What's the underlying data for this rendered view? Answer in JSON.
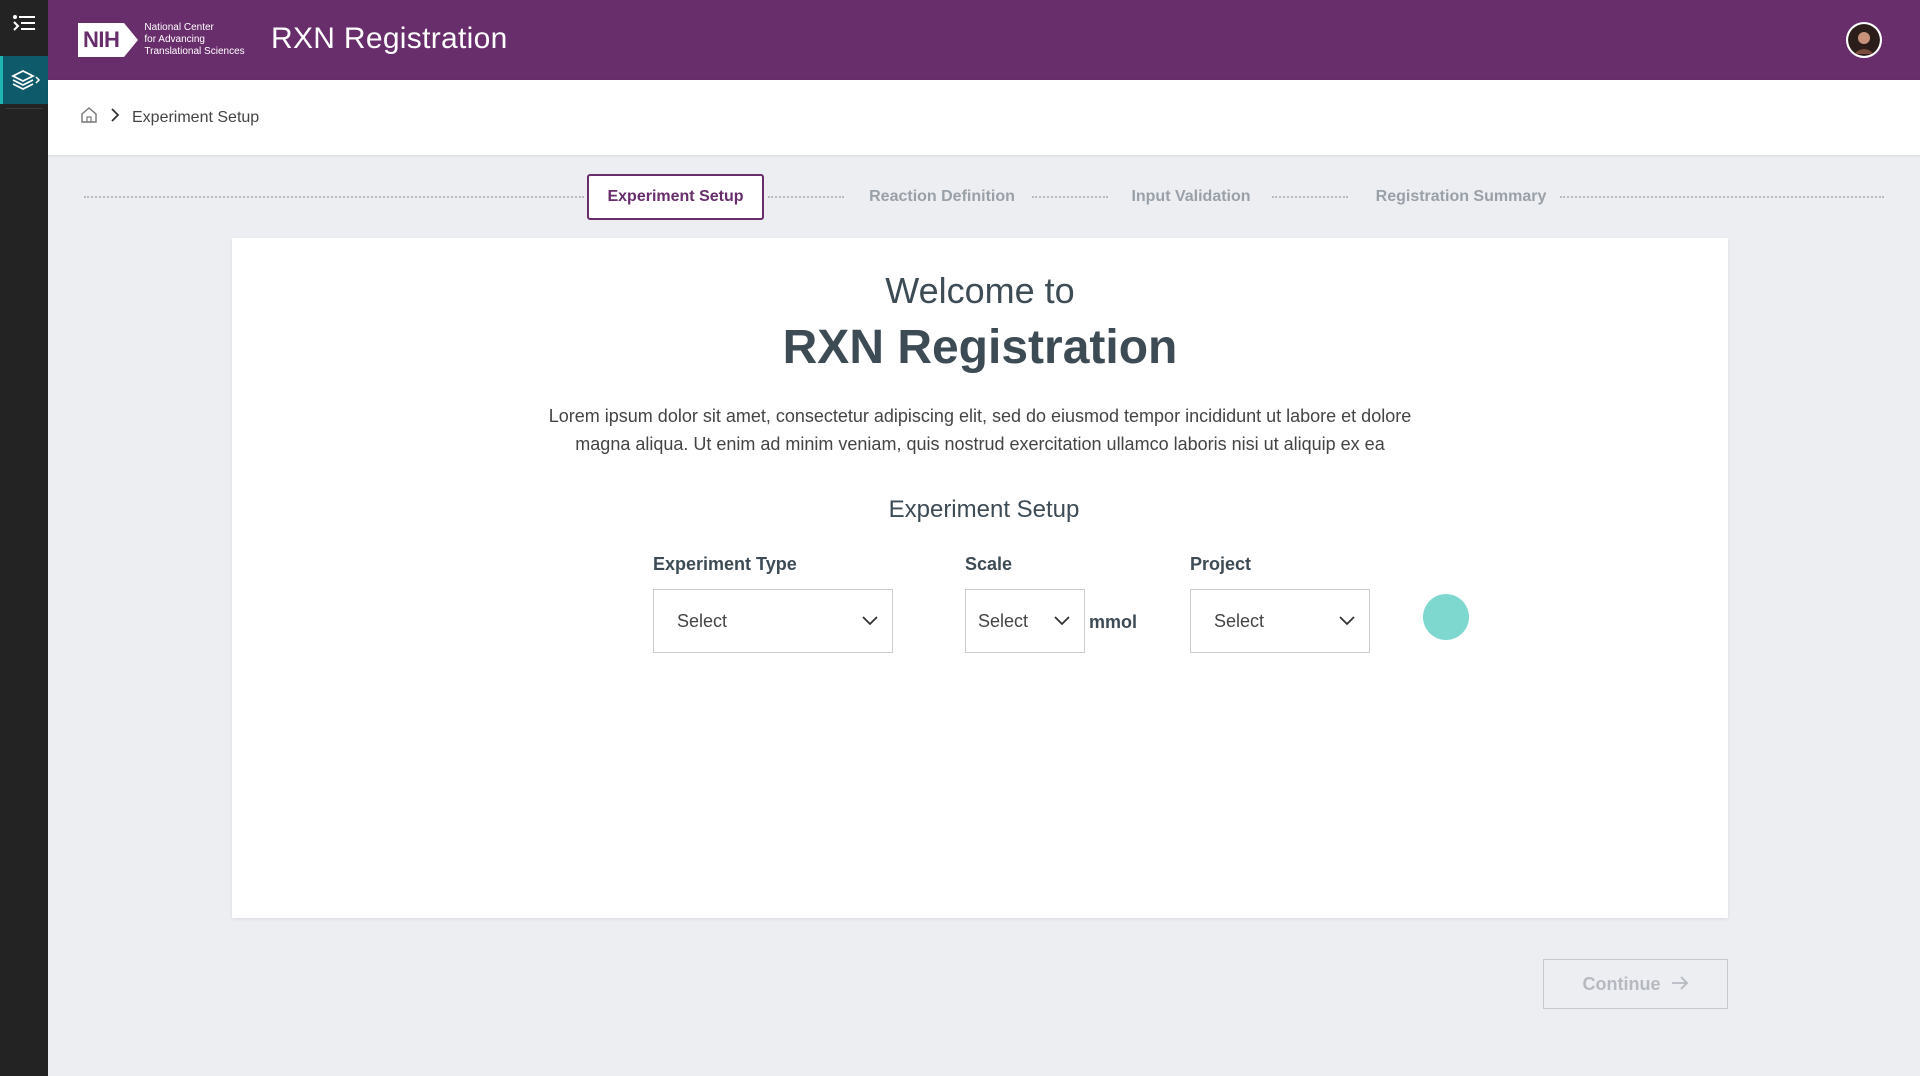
{
  "header": {
    "logo_text": "NIH",
    "org_name_line1": "National Center",
    "org_name_line2": "for Advancing",
    "org_name_line3": "Translational Sciences",
    "app_title": "RXN Registration"
  },
  "sidebar": {
    "icons": [
      "menu-list-icon",
      "layers-icon"
    ]
  },
  "breadcrumb": {
    "items": [
      "Experiment Setup"
    ]
  },
  "stepper": {
    "steps": [
      {
        "label": "Experiment Setup",
        "active": true
      },
      {
        "label": "Reaction Definition",
        "active": false
      },
      {
        "label": "Input Validation",
        "active": false
      },
      {
        "label": "Registration Summary",
        "active": false
      }
    ]
  },
  "welcome": {
    "line1": "Welcome to",
    "title": "RXN Registration",
    "description_line1": "Lorem ipsum dolor sit amet, consectetur adipiscing elit, sed do eiusmod tempor incididunt ut labore et dolore",
    "description_line2": "magna aliqua. Ut enim ad minim veniam, quis nostrud exercitation ullamco laboris nisi ut aliquip ex ea"
  },
  "form": {
    "section_title": "Experiment Setup",
    "experiment_type": {
      "label": "Experiment Type",
      "value": "Select"
    },
    "scale": {
      "label": "Scale",
      "value": "Select",
      "unit": "mmol"
    },
    "project": {
      "label": "Project",
      "value": "Select"
    }
  },
  "actions": {
    "continue_label": "Continue"
  },
  "colors": {
    "brand": "#682d6b",
    "accent": "#1fb5b0",
    "spinner": "#7fd8cf"
  }
}
